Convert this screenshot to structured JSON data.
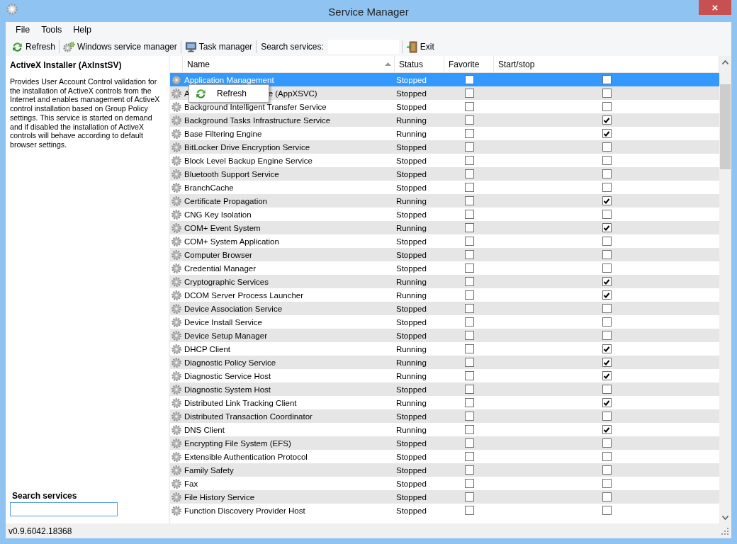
{
  "window": {
    "title": "Service Manager",
    "close": "×"
  },
  "menu": [
    "File",
    "Tools",
    "Help"
  ],
  "toolbar": {
    "buttons": [
      {
        "label": "Refresh",
        "kind": "refresh"
      },
      {
        "label": "Windows service manager",
        "kind": "services"
      },
      {
        "label": "Task manager",
        "kind": "monitor"
      }
    ],
    "search_label": "Search services:",
    "exit": "Exit"
  },
  "details": {
    "title": "ActiveX Installer (AxInstSV)",
    "description": "Provides User Account Control validation for the installation of ActiveX controls from the Internet and enables management of ActiveX control installation based on Group Policy settings. This service is started on demand and if disabled the installation of ActiveX controls will behave according to default browser settings.",
    "search_label": "Search services"
  },
  "table": {
    "columns": [
      {
        "label": "Name",
        "sorted": true
      },
      {
        "label": "Status",
        "sorted": false
      },
      {
        "label": "Favorite",
        "sorted": false
      },
      {
        "label": "Start/stop",
        "sorted": false
      }
    ],
    "rows": [
      {
        "name": "Application Management",
        "status": "Stopped",
        "favorite": false,
        "start_stop": false,
        "selected": true
      },
      {
        "name": "A",
        "name_after_menu": "e (AppXSVC)",
        "status": "Stopped",
        "favorite": false,
        "start_stop": false,
        "selected": false
      },
      {
        "name": "Background Intelligent Transfer Service",
        "status": "Stopped",
        "favorite": false,
        "start_stop": false,
        "selected": false
      },
      {
        "name": "Background Tasks Infrastructure Service",
        "status": "Running",
        "favorite": false,
        "start_stop": true,
        "selected": false
      },
      {
        "name": "Base Filtering Engine",
        "status": "Running",
        "favorite": false,
        "start_stop": true,
        "selected": false
      },
      {
        "name": "BitLocker Drive Encryption Service",
        "status": "Stopped",
        "favorite": false,
        "start_stop": false,
        "selected": false
      },
      {
        "name": "Block Level Backup Engine Service",
        "status": "Stopped",
        "favorite": false,
        "start_stop": false,
        "selected": false
      },
      {
        "name": "Bluetooth Support Service",
        "status": "Stopped",
        "favorite": false,
        "start_stop": false,
        "selected": false
      },
      {
        "name": "BranchCache",
        "status": "Stopped",
        "favorite": false,
        "start_stop": false,
        "selected": false
      },
      {
        "name": "Certificate Propagation",
        "status": "Running",
        "favorite": false,
        "start_stop": true,
        "selected": false
      },
      {
        "name": "CNG Key Isolation",
        "status": "Stopped",
        "favorite": false,
        "start_stop": false,
        "selected": false
      },
      {
        "name": "COM+ Event System",
        "status": "Running",
        "favorite": false,
        "start_stop": true,
        "selected": false
      },
      {
        "name": "COM+ System Application",
        "status": "Stopped",
        "favorite": false,
        "start_stop": false,
        "selected": false
      },
      {
        "name": "Computer Browser",
        "status": "Stopped",
        "favorite": false,
        "start_stop": false,
        "selected": false
      },
      {
        "name": "Credential Manager",
        "status": "Stopped",
        "favorite": false,
        "start_stop": false,
        "selected": false
      },
      {
        "name": "Cryptographic Services",
        "status": "Running",
        "favorite": false,
        "start_stop": true,
        "selected": false
      },
      {
        "name": "DCOM Server Process Launcher",
        "status": "Running",
        "favorite": false,
        "start_stop": true,
        "selected": false
      },
      {
        "name": "Device Association Service",
        "status": "Stopped",
        "favorite": false,
        "start_stop": false,
        "selected": false
      },
      {
        "name": "Device Install Service",
        "status": "Stopped",
        "favorite": false,
        "start_stop": false,
        "selected": false
      },
      {
        "name": "Device Setup Manager",
        "status": "Stopped",
        "favorite": false,
        "start_stop": false,
        "selected": false
      },
      {
        "name": "DHCP Client",
        "status": "Running",
        "favorite": false,
        "start_stop": true,
        "selected": false
      },
      {
        "name": "Diagnostic Policy Service",
        "status": "Running",
        "favorite": false,
        "start_stop": true,
        "selected": false
      },
      {
        "name": "Diagnostic Service Host",
        "status": "Running",
        "favorite": false,
        "start_stop": true,
        "selected": false
      },
      {
        "name": "Diagnostic System Host",
        "status": "Stopped",
        "favorite": false,
        "start_stop": false,
        "selected": false
      },
      {
        "name": "Distributed Link Tracking Client",
        "status": "Running",
        "favorite": false,
        "start_stop": true,
        "selected": false
      },
      {
        "name": "Distributed Transaction Coordinator",
        "status": "Stopped",
        "favorite": false,
        "start_stop": false,
        "selected": false
      },
      {
        "name": "DNS Client",
        "status": "Running",
        "favorite": false,
        "start_stop": true,
        "selected": false
      },
      {
        "name": "Encrypting File System (EFS)",
        "status": "Stopped",
        "favorite": false,
        "start_stop": false,
        "selected": false
      },
      {
        "name": "Extensible Authentication Protocol",
        "status": "Stopped",
        "favorite": false,
        "start_stop": false,
        "selected": false
      },
      {
        "name": "Family Safety",
        "status": "Stopped",
        "favorite": false,
        "start_stop": false,
        "selected": false
      },
      {
        "name": "Fax",
        "status": "Stopped",
        "favorite": false,
        "start_stop": false,
        "selected": false
      },
      {
        "name": "File History Service",
        "status": "Stopped",
        "favorite": false,
        "start_stop": false,
        "selected": false
      },
      {
        "name": "Function Discovery Provider Host",
        "status": "Stopped",
        "favorite": false,
        "start_stop": false,
        "selected": false
      }
    ]
  },
  "context_menu": {
    "items": [
      {
        "label": "Refresh",
        "kind": "refresh"
      }
    ]
  },
  "status_bar": "v0.9.6042.18368"
}
